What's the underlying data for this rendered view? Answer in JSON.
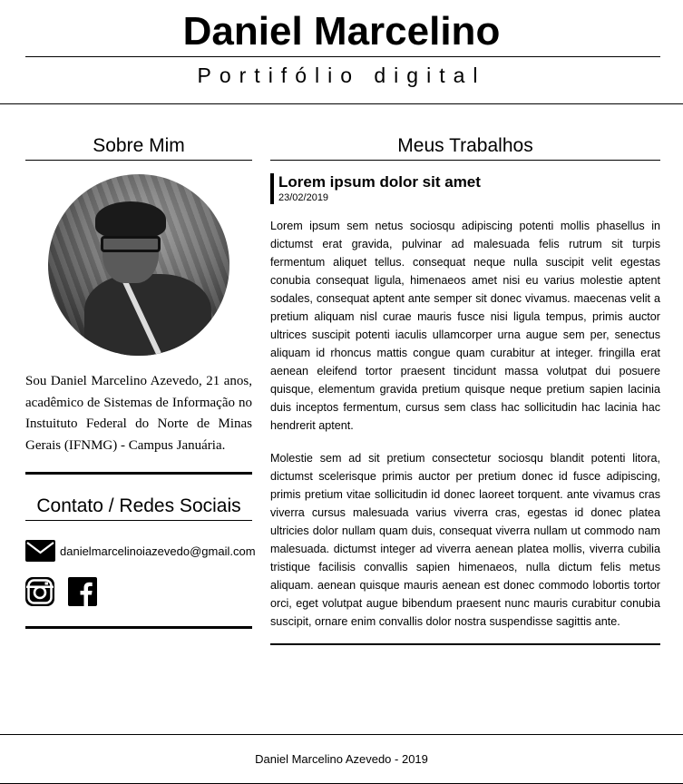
{
  "header": {
    "title": "Daniel Marcelino",
    "subtitle": "Portifólio digital"
  },
  "sidebar": {
    "about_title": "Sobre Mim",
    "about_text": "Sou Daniel Marcelino Azevedo, 21 anos, acadêmico de Sistemas de Informação no Instuituto Federal do Norte de Minas Gerais (IFNMG) - Campus Januária.",
    "contact_title": "Contato / Redes Sociais",
    "email": "danielmarcelinoiazevedo@gmail.com",
    "social_icons": [
      "instagram-icon",
      "facebook-icon"
    ]
  },
  "main": {
    "section_title": "Meus Trabalhos",
    "post": {
      "title": "Lorem ipsum dolor sit amet",
      "date": "23/02/2019",
      "paragraphs": [
        "Lorem ipsum sem netus sociosqu adipiscing potenti mollis phasellus in dictumst erat gravida, pulvinar ad malesuada felis rutrum sit turpis fermentum aliquet tellus. consequat neque nulla suscipit velit egestas conubia consequat ligula, himenaeos amet nisi eu varius molestie aptent sodales, consequat aptent ante semper sit donec vivamus. maecenas velit a pretium aliquam nisl curae mauris fusce nisi ligula tempus, primis auctor ultrices suscipit potenti iaculis ullamcorper urna augue sem per, senectus aliquam id rhoncus mattis congue quam curabitur at integer. fringilla erat aenean eleifend tortor praesent tincidunt massa volutpat dui posuere quisque, elementum gravida pretium quisque neque pretium sapien lacinia duis inceptos fermentum, cursus sem class hac sollicitudin hac lacinia hac hendrerit aptent.",
        "Molestie sem ad sit pretium consectetur sociosqu blandit potenti litora, dictumst scelerisque primis auctor per pretium donec id fusce adipiscing, primis pretium vitae sollicitudin id donec laoreet torquent. ante vivamus cras viverra cursus malesuada varius viverra cras, egestas id donec platea ultricies dolor nullam quam duis, consequat viverra nullam ut commodo nam malesuada. dictumst integer ad viverra aenean platea mollis, viverra cubilia tristique facilisis convallis sapien himenaeos, nulla dictum felis metus aliquam. aenean quisque mauris aenean est donec commodo lobortis tortor orci, eget volutpat augue bibendum praesent nunc mauris curabitur conubia suscipit, ornare enim convallis dolor nostra suspendisse sagittis ante."
      ]
    }
  },
  "footer": {
    "text": "Daniel Marcelino Azevedo - 2019"
  },
  "colors": {
    "text": "#000000",
    "background": "#ffffff"
  }
}
